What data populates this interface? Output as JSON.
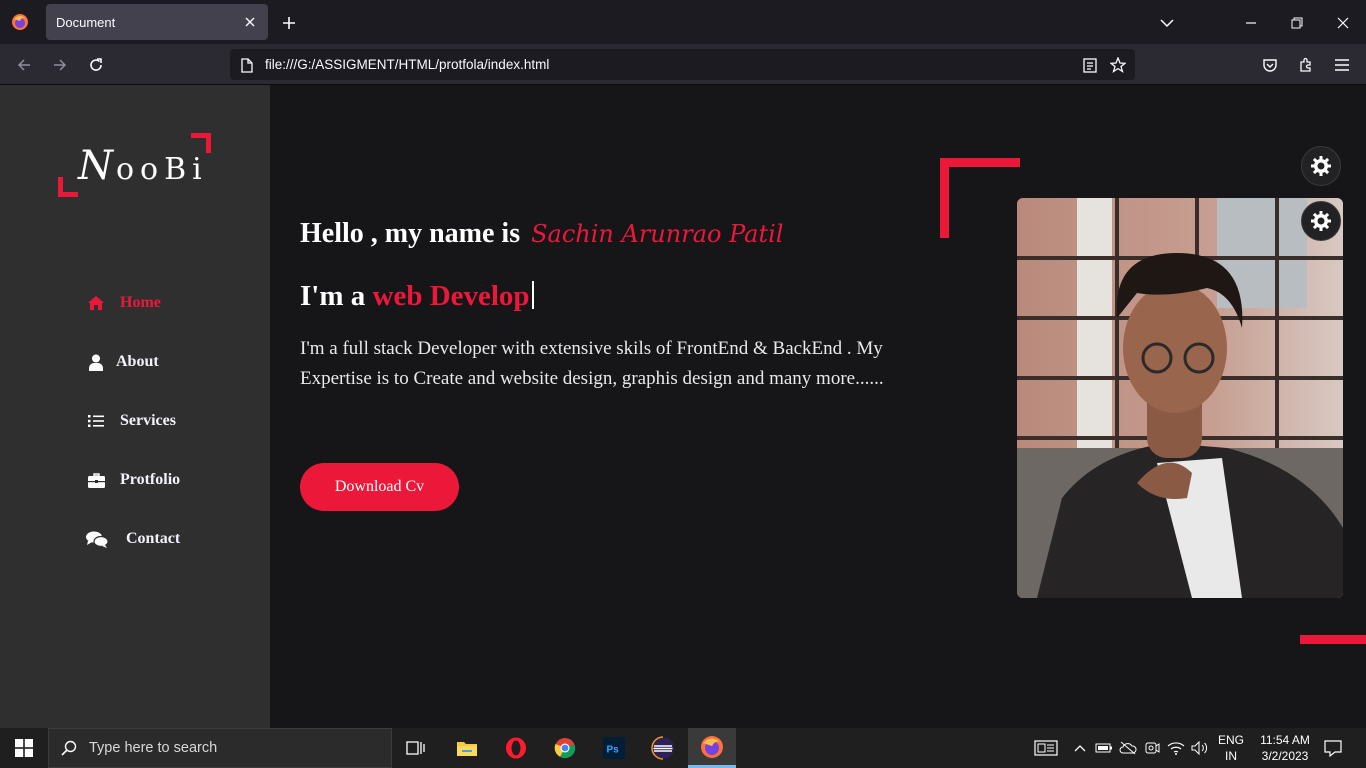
{
  "browser": {
    "tab_title": "Document",
    "url": "file:///G:/ASSIGMENT/HTML/protfola/index.html"
  },
  "logo": {
    "first_letter": "N",
    "rest": "ooBi"
  },
  "sidebar": {
    "items": [
      {
        "label": "Home",
        "icon": "home-icon",
        "active": true
      },
      {
        "label": "About",
        "icon": "user-icon",
        "active": false
      },
      {
        "label": "Services",
        "icon": "list-icon",
        "active": false
      },
      {
        "label": "Protfolio",
        "icon": "briefcase-icon",
        "active": false
      },
      {
        "label": "Contact",
        "icon": "comments-icon",
        "active": false
      }
    ]
  },
  "hero": {
    "greeting": "Hello , my name is",
    "name": "Sachin Arunrao Patil",
    "role_prefix": "I'm a",
    "role_typed": "web Develop",
    "description": "I'm a full stack Developer with extensive skils of FrontEnd & BackEnd . My Expertise is to Create and website design, graphis design and many more......",
    "cv_button": "Download Cv"
  },
  "colors": {
    "accent": "#ec1839",
    "sidebar_bg": "#2f2f30",
    "page_bg": "#161618"
  },
  "taskbar": {
    "search_placeholder": "Type here to search",
    "lang_line1": "ENG",
    "lang_line2": "IN",
    "time": "11:54 AM",
    "date": "3/2/2023"
  }
}
